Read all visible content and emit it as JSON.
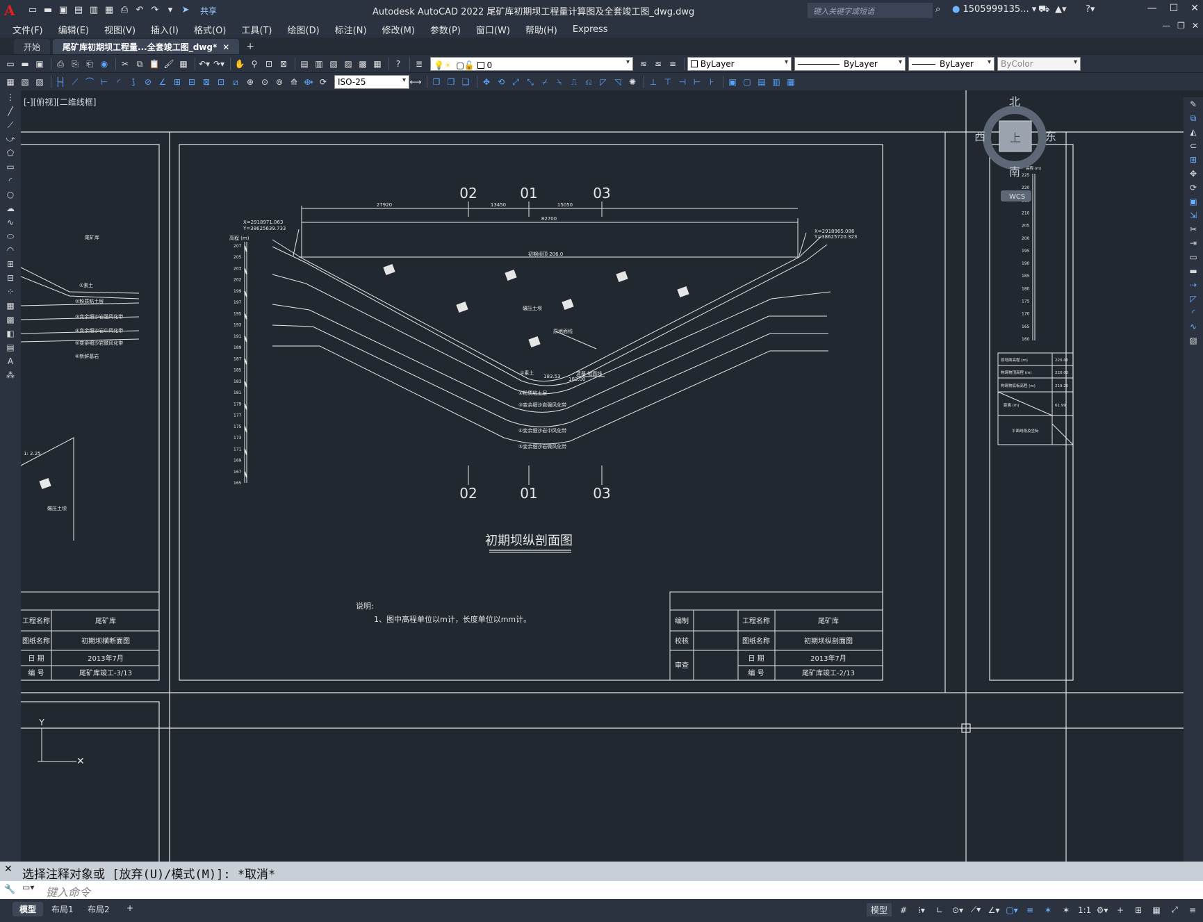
{
  "app": {
    "title": "Autodesk AutoCAD 2022    尾矿库初期坝工程量计算图及全套竣工图_dwg.dwg",
    "share_label": "共享",
    "search_placeholder": "键入关键字或短语",
    "user_name": "1505999135..."
  },
  "menu": [
    "文件(F)",
    "编辑(E)",
    "视图(V)",
    "插入(I)",
    "格式(O)",
    "工具(T)",
    "绘图(D)",
    "标注(N)",
    "修改(M)",
    "参数(P)",
    "窗口(W)",
    "帮助(H)",
    "Express"
  ],
  "tabs": [
    {
      "label": "开始"
    },
    {
      "label": "尾矿库初期坝工程量...全套竣工图_dwg*"
    }
  ],
  "toolbar": {
    "layer_value": "0",
    "color_value": "ByLayer",
    "linetype_value": "ByLayer",
    "lineweight_value": "ByLayer",
    "plotstyle_value": "ByColor",
    "dimstyle_value": "ISO-25"
  },
  "viewport": {
    "label": "[-][俯视][二维线框]",
    "compass": {
      "n": "北",
      "s": "南",
      "e": "东",
      "w": "西",
      "top": "上",
      "wcs": "WCS"
    }
  },
  "drawing": {
    "title": "初期坝纵剖面图",
    "section_labels": [
      "02",
      "01",
      "03"
    ],
    "dims": {
      "d1": "27920",
      "d2": "13450",
      "d3": "15050",
      "total": "82700"
    },
    "coord_left": [
      "X=2918971.063",
      "Y=38625639.733"
    ],
    "coord_right": [
      "X=2918965.086",
      "Y=38625720.323"
    ],
    "elev_axis_title": "高程 (m)",
    "elev_ticks": [
      "207",
      "205",
      "203",
      "202",
      "199",
      "197",
      "195",
      "193",
      "191",
      "189",
      "187",
      "185",
      "183",
      "181",
      "179",
      "177",
      "175",
      "173",
      "171",
      "169",
      "167",
      "165"
    ],
    "crest_label": "初期坝顶 206.0",
    "body_label": "碾压土坝",
    "ground_label": "原地面线",
    "bed_label": "清基 地面线",
    "elev_small_1": "183.53",
    "elev_small_2": "183.00",
    "layers": [
      "①素土",
      "②粉质粘土层",
      "③变余细沙岩强风化带",
      "④变余细沙岩中风化带",
      "⑤变余细沙岩微风化带"
    ],
    "notes_title": "说明:",
    "notes": [
      "1、图中高程单位以m计，长度单位以mm计。"
    ],
    "titleblock": {
      "bianzhi": "编制",
      "jiaohe": "校核",
      "shencha": "审查",
      "proj_label": "工程名称",
      "proj_value": "尾矿库",
      "drawing_label": "图纸名称",
      "drawing_value": "初期坝纵剖面图",
      "date_label": "日    期",
      "date_value": "2013年7月",
      "num_label": "编    号",
      "num_value": "尾矿库竣工-2/13"
    },
    "left_titleblock": {
      "proj_label": "工程名称",
      "proj_value": "尾矿库",
      "drawing_label": "图纸名称",
      "drawing_value": "初期坝横断面图",
      "date_label": "日    期",
      "date_value": "2013年7月",
      "num_label": "编    号",
      "num_value": "尾矿库竣工-3/13"
    },
    "left_layers": [
      "①素土",
      "②粉质粘土层",
      "③变余细沙岩强风化带",
      "④变余细沙岩中风化带",
      "⑤变余细沙岩微风化带",
      "⑥新鲜基岩"
    ],
    "left_labels": {
      "tailings": "尾矿库",
      "body": "碾压土坝",
      "slope": "1: 2.25"
    },
    "right_axis_title": "高程 (m)",
    "right_ticks": [
      "225",
      "220",
      "215",
      "210",
      "205",
      "200",
      "195",
      "190",
      "185",
      "180",
      "175",
      "170",
      "165",
      "160"
    ],
    "right_table": [
      "原地面高程 (m)",
      "构筑物顶高程 (m)",
      "构筑物底板高程 (m)",
      "距离 (m)",
      "平面线段及坐标"
    ],
    "right_table_vals": [
      "220.00",
      "220.00",
      "219.20",
      "61.99"
    ]
  },
  "command": {
    "history": "选择注释对象或 [放弃(U)/模式(M)]: *取消*",
    "placeholder": "键入命令"
  },
  "status": {
    "tabs": [
      "模型",
      "布局1",
      "布局2"
    ],
    "model_label": "模型",
    "scale": "1:1"
  },
  "colors": {
    "background": "#212830",
    "chrome": "#2b3340",
    "accent": "#5aa6ff"
  }
}
